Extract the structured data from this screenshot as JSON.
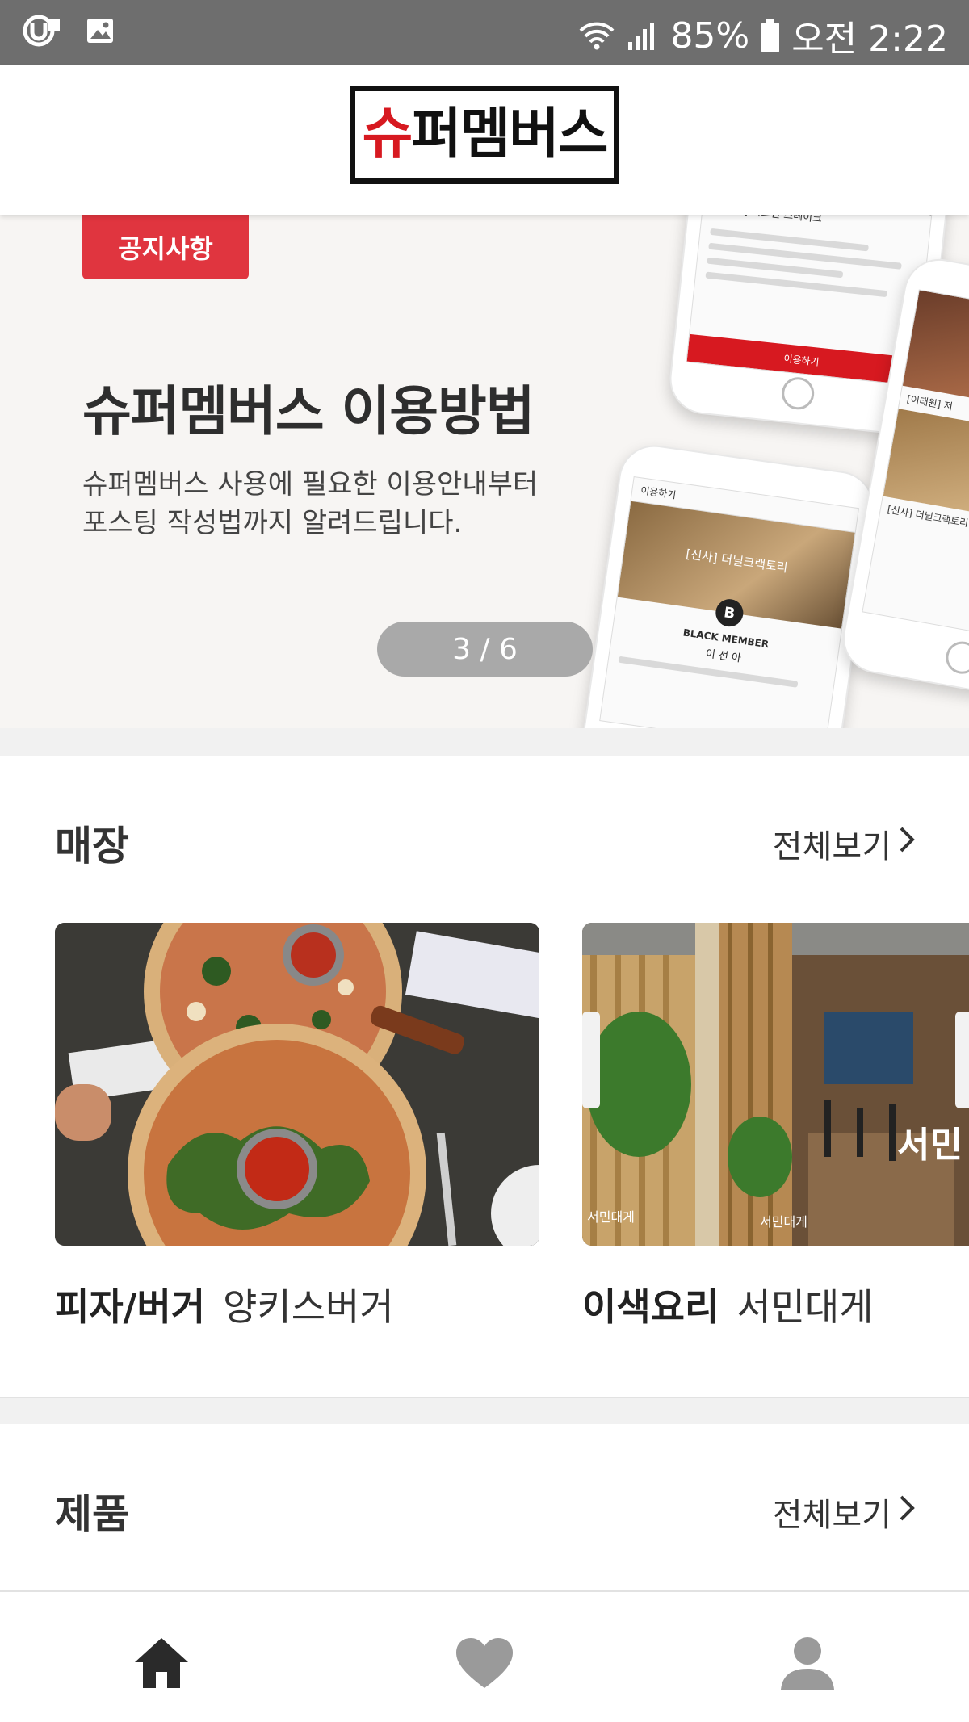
{
  "status_bar": {
    "battery": "85%",
    "time": "오전 2:22",
    "icons": [
      "u-plus-icon",
      "image-icon",
      "wifi-icon",
      "signal-icon",
      "battery-icon"
    ]
  },
  "header": {
    "logo_text_red": "슈",
    "logo_text_black": "퍼멤버스"
  },
  "banner": {
    "badge": "공지사항",
    "title": "슈퍼멤버스 이용방법",
    "desc_line1": "슈퍼멤버스 사용에 필요한 이용안내부터",
    "desc_line2": "포스팅 작성법까지 알려드립니다.",
    "pager": "3 / 6",
    "phone_texts": {
      "p1_title": "[이태원] 저스틴 스테이크",
      "p1_button": "이용하기",
      "p2_nav": "이용하기",
      "p2_store": "[신사] 더닐크랙토리",
      "p2_badge": "B",
      "p2_member": "BLACK MEMBER",
      "p2_name": "이 선 아",
      "p3_store1": "[이태원] 저",
      "p3_store2": "[신사] 더닐크랙토리"
    }
  },
  "stores_section": {
    "title": "매장",
    "see_all": "전체보기",
    "cards": [
      {
        "category": "피자/버거",
        "name": "양키스버거"
      },
      {
        "category": "이색요리",
        "name": "서민대게"
      }
    ],
    "photo_text": {
      "sign_big": "서민",
      "sign_small_1": "서민대게",
      "sign_small_2": "서민대게"
    }
  },
  "products_section": {
    "title": "제품",
    "see_all": "전체보기"
  },
  "colors": {
    "accent_red": "#d71920",
    "badge_red": "#e0353f",
    "status_bar_bg": "#6e6e6e",
    "nav_active": "#2a2a2a",
    "nav_inactive": "#9a9a9a"
  },
  "bottom_nav": {
    "items": [
      {
        "icon": "home-icon",
        "active": true
      },
      {
        "icon": "heart-icon",
        "active": false
      },
      {
        "icon": "person-icon",
        "active": false
      }
    ]
  }
}
